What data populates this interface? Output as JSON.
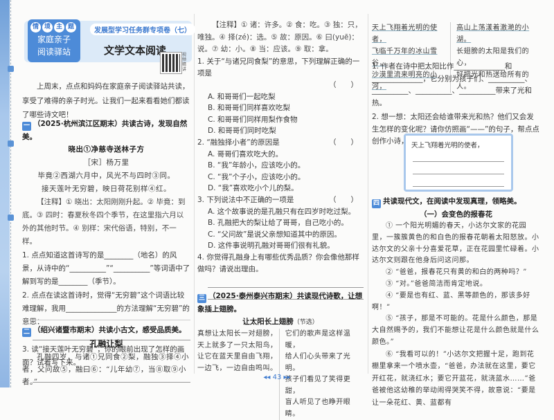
{
  "header": {
    "tags": [
      "情",
      "境",
      "主",
      "题"
    ],
    "theme": [
      "家庭亲子",
      "阅读驿站"
    ],
    "subtitle": "发展型学习任务群专项卷（七）",
    "title": "文学文本阅读",
    "qr_label": "视频精讲"
  },
  "intro": "上周末，点点和妈妈在家庭亲子阅读驿站共读，享受了难得的亲子时光。让我们一起来看看她们都读了哪些诗文吧！",
  "s1": {
    "mark": "一",
    "heading": "（2025·杭州滨江区期末）共读古诗，发现自然美。",
    "poem_title": "晓出①净慈寺送林子方",
    "author": "［宋］杨万里",
    "lines": [
      "毕竟②西湖六月中，风光不与四时③同。",
      "接天莲叶无穷碧，映日荷花别样④红。"
    ],
    "note": "【注释】① 晓出：太阳刚刚升起。② 毕竟：到底。③ 四时：春夏秋冬四个季节，在这里指六月以外的其他时节。④ 别样：宋代俗语，特别，不一样。",
    "q1": "1. 点点知道这首诗写的是________（地名）的风景，从诗中的“__________”“__________”等词语中了解到写的是________（季节）。",
    "q2": "2. 点点在读这首诗时，觉得“无穷碧”这个词语比较难理解，我用______________的方法理解“无穷碧”的意思：",
    "q3": "3. 读“接天莲叶无穷碧”，你的眼前出现了怎样的画面？试着写下来。"
  },
  "s2": {
    "mark": "二",
    "heading": "（绍兴诸暨市期末）共读小古文，感受品质美。",
    "title": "孔融让梨",
    "text": "孔融四岁，与诸①兄同食②梨，融独③择④小者，父问故⑤，融曰⑥：“儿年幼⑦，当⑧取⑨小者。”",
    "note": "【注释】① 诸：许多。② 食：吃。③ 独：只，唯独。④ 择(zé)：选。⑤ 故：原因。⑥ 曰(yuē)：说。⑦ 幼：小。⑧ 当：应该。⑨ 取：拿。",
    "paren": "（　　）",
    "questions": [
      {
        "stem": "1. 关于“与诸兄同食梨”的意思，下列理解正确的一项是",
        "options": [
          "A. 和哥哥们一起吃梨",
          "B. 和哥哥们同样喜欢吃梨",
          "C. 和哥哥们同样用梨作食物",
          "D. 和哥哥们同时吃梨"
        ]
      },
      {
        "stem": "2. “融独择小者”的原因是",
        "options": [
          "A. 哥哥们喜欢吃大的。",
          "B. “我”年龄小，应该吃小的。",
          "C. “我”个子小，应该吃小的。",
          "D. “我”喜欢吃小个儿的梨。"
        ]
      },
      {
        "stem": "3. 下列说法中不正确的一项是",
        "options": [
          "A. 这个故事说的是孔融只有在四岁时吃过梨。",
          "B. 孔融把大的梨让给了哥哥，自己吃小的。",
          "C. “父问故”是说父亲想知道其中的原因。",
          "D. 这件事说明孔融对哥哥们很有礼貌。"
        ]
      }
    ],
    "q4": "4. 你觉得孔融身上有哪些优秀品质？你会像他那样做吗？请说出理由。"
  },
  "s3": {
    "mark": "三",
    "heading": "（2025·泰州泰兴市期末）共读现代诗歌，让想象插上翅膀。",
    "poem_title": "让太阳长上翅膀",
    "excerpt": "（节选）",
    "left": [
      "真想让太阳长一对翅膀，",
      "天上就多了一只太阳鸟，",
      "让它在蓝天里自由飞翔，",
      "一边飞，一边自由鸣叫。"
    ],
    "right": [
      "它们的歌声是这样温暖，",
      "给人们心头带来了光明。",
      "孩子们看见了笑得更甜，",
      "盲人听见了也睁开眼睛。"
    ],
    "left2": [
      "天上飞翔着光明的使者，",
      "飞临千万年的冰山雪谷，",
      "沙漠里流来明亮的小河，"
    ],
    "right2": [
      "高山上荡漾着激滟的小湖。",
      "长翅膀的太阳是我们的心，",
      "好把光和热送给所有的人。"
    ],
    "q1": "1. 作者在诗中把太阳比作______________和______________，它分别为孩子们、__________、__________、__________、__________带来了光和热。",
    "q2": "2. 想一想：太阳还会给谁带来光和热？他们又会发生怎样的变化呢？请你仿照画“——”的句子，帮点点创作小诗，分享到朋友圈。",
    "box_line": "天上飞翔着光明的使者，"
  },
  "s4": {
    "mark": "四",
    "heading": "共读现代文，在阅读中发现真理，领略美。",
    "title": "（一）会变色的报春花",
    "paras": [
      "① 一个阳光明媚的春天，小达尔文家的花园里，一簇簇黄色的和白色的报春花朝着太阳怒放。小达尔文的父亲十分喜爱花草，正在花园里忙碌着。小达尔文则跟在他身后问这问那。",
      "② “爸爸，报春花只有黄的和白的两种吗？”",
      "③ “对。”爸爸简洁而肯定地说。",
      "④ “要是也有红、蓝、黑等颜色的，那该多好啊！”",
      "⑤ “孩子，那是不可能的。花是什么颜色，那是大自然赐予的，我们不能想让花是什么颜色就是什么颜色。”",
      "⑥ “我看可以的！”小达尔文把握十足，跑到花棚里拿来一个喷水壶，“爸爸，办法就在这里，要它开红花，就浇红水；要它开蓝花，就浇蓝水……”爸爸被他这幼稚的举动闹得哭笑不得，故意说：“要是让一朵花红、黄、蓝都有"
    ]
  },
  "page_number": "43",
  "colors": {
    "accent": "#4d8bd8",
    "banner": "#dceaf8"
  }
}
